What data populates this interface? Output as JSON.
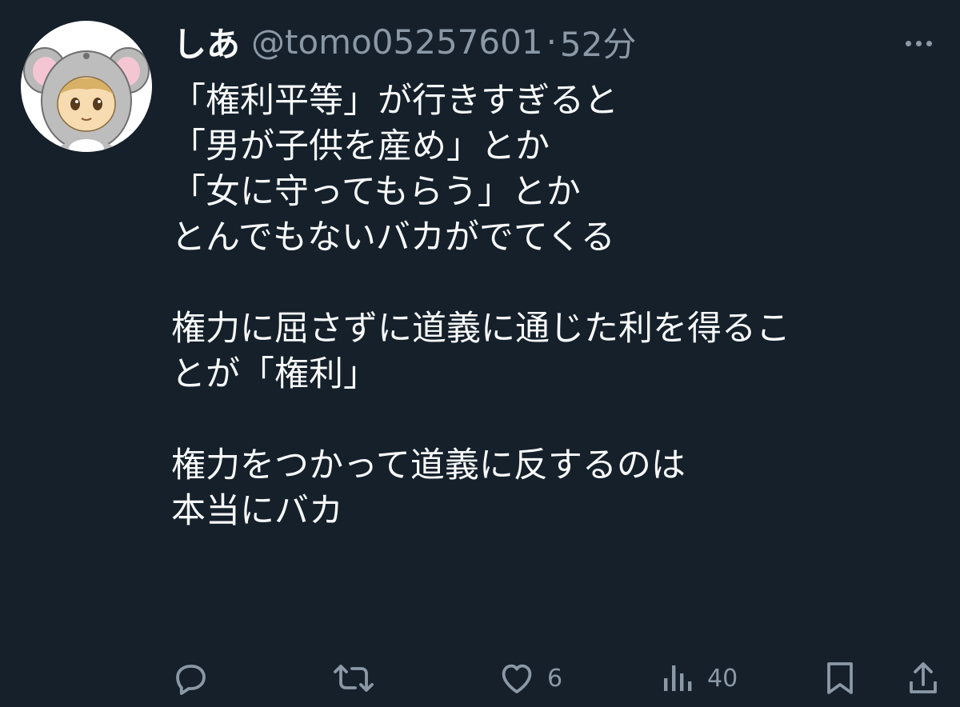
{
  "tweet": {
    "author": {
      "display_name": "しあ",
      "handle": "@tomo05257601",
      "separator": "·",
      "timestamp": "52分"
    },
    "lines": [
      "「権利平等」が行きすぎると",
      "「男が子供を産め」とか",
      "「女に守ってもらう」とか",
      "とんでもないバカがでてくる",
      "",
      "権力に屈さずに道義に通じた利を得るこ",
      "とが「権利」",
      "",
      "権力をつかって道義に反するのは",
      "本当にバカ"
    ],
    "actions": {
      "reply": {
        "icon": "reply-icon",
        "count": ""
      },
      "retweet": {
        "icon": "retweet-icon",
        "count": ""
      },
      "like": {
        "icon": "heart-icon",
        "count": "6"
      },
      "views": {
        "icon": "views-icon",
        "count": "40"
      },
      "bookmark": {
        "icon": "bookmark-icon",
        "count": ""
      },
      "share": {
        "icon": "share-icon",
        "count": ""
      }
    }
  },
  "colors": {
    "background": "#15202b",
    "text_primary": "#f7f9f9",
    "text_secondary": "#8b98a5"
  }
}
